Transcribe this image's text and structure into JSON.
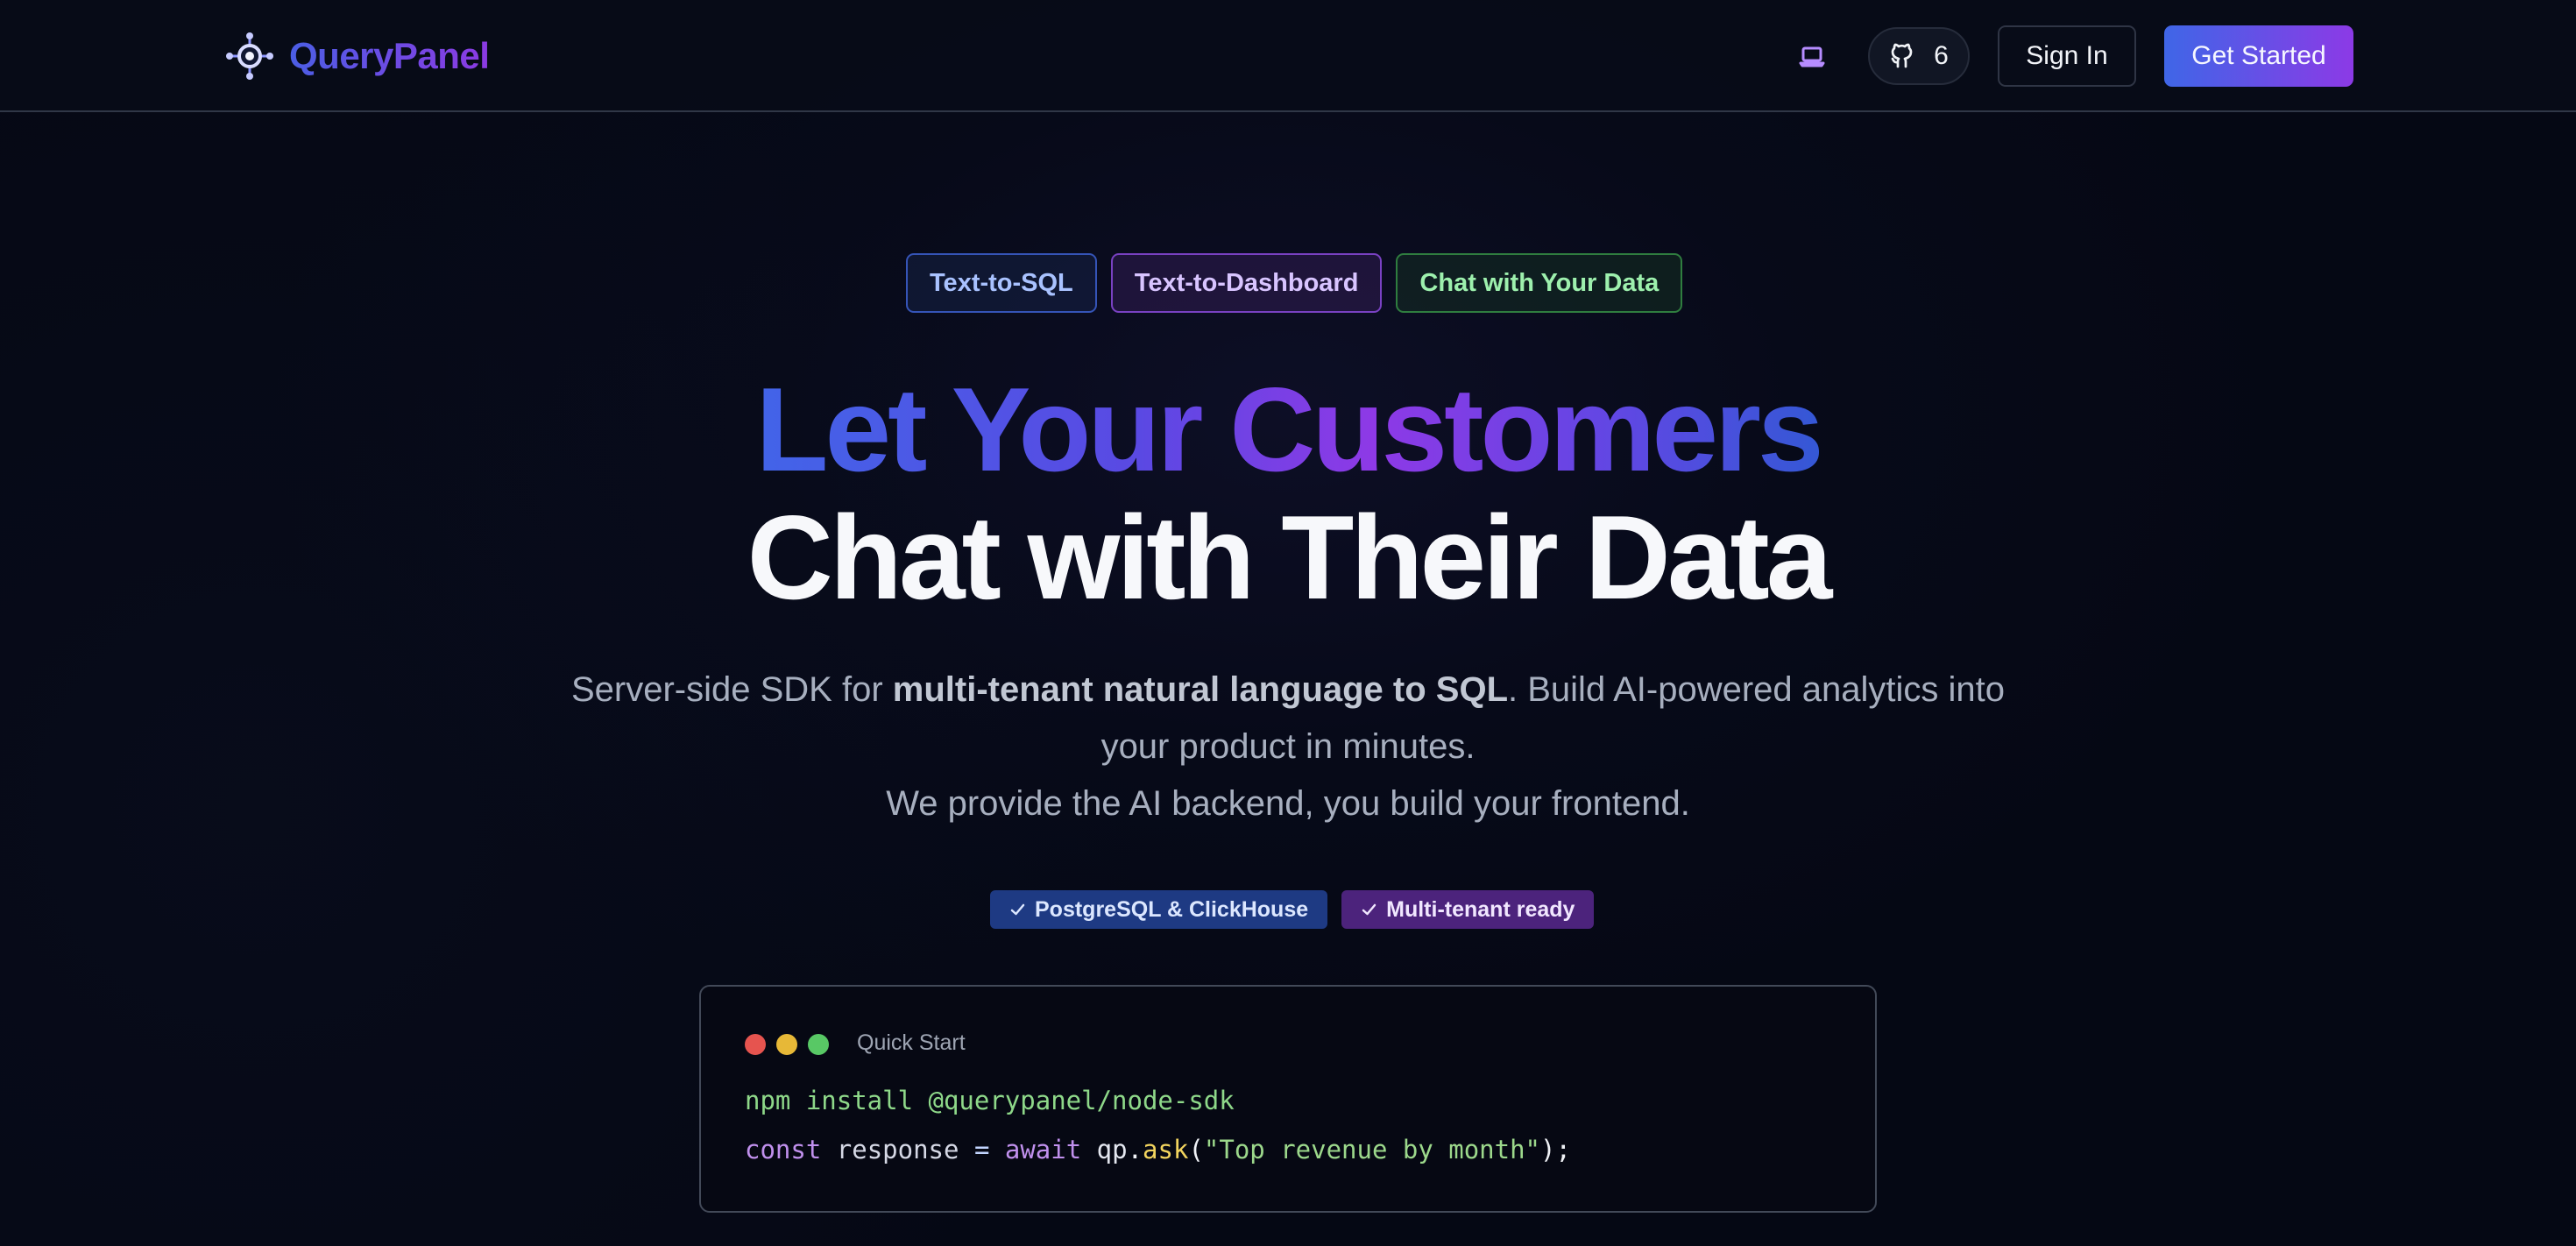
{
  "header": {
    "brand": "QueryPanel",
    "icons": {
      "logo": "network-node-icon",
      "theme": "laptop-icon",
      "github": "github-icon"
    },
    "github_count": "6",
    "sign_in_label": "Sign In",
    "get_started_label": "Get Started"
  },
  "hero": {
    "tags": [
      "Text-to-SQL",
      "Text-to-Dashboard",
      "Chat with Your Data"
    ],
    "title_line_1": "Let Your Customers",
    "title_line_2": "Chat with Their Data",
    "subtitle": {
      "before_bold": "Server-side SDK for ",
      "bold": "multi-tenant natural language to SQL",
      "after_bold": ". Build AI-powered analytics into your product in minutes.",
      "second_line": "We provide the AI backend, you build your frontend."
    },
    "features": [
      "PostgreSQL & ClickHouse",
      "Multi-tenant ready"
    ]
  },
  "quick_start": {
    "title": "Quick Start",
    "install_command": "npm install @querypanel/node-sdk",
    "code": {
      "const": "const",
      "variable": "response",
      "equals": "=",
      "await": "await",
      "object": "qp",
      "dot": ".",
      "method": "ask",
      "open_paren": "(",
      "argument": "\"Top revenue by month\"",
      "close_paren_semicolon": ");"
    }
  },
  "colors": {
    "background": "#050814",
    "brand_blue": "#3b67e8",
    "brand_purple": "#8d3ae6",
    "success_green": "#58c865"
  }
}
